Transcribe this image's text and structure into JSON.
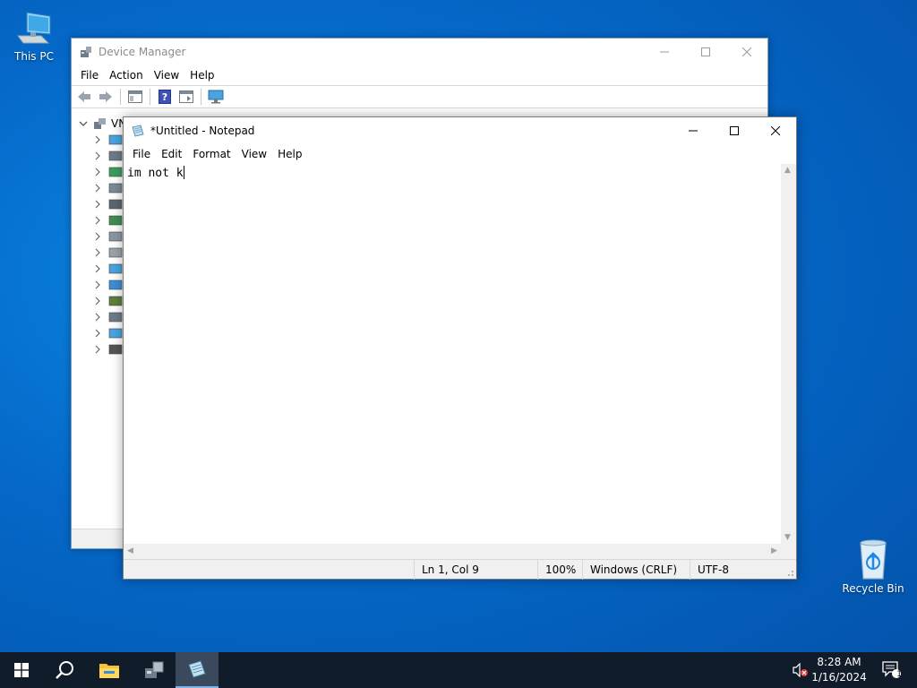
{
  "desktop": {
    "icons": [
      {
        "label": "This PC",
        "icon": "computer-icon"
      },
      {
        "label": "Recycle Bin",
        "icon": "recycle-bin-icon"
      }
    ]
  },
  "device_manager": {
    "title": "Device Manager",
    "menu": [
      "File",
      "Action",
      "View",
      "Help"
    ],
    "tree_root_label": "VN",
    "window_controls": [
      "minimize-icon",
      "maximize-icon",
      "close-icon"
    ]
  },
  "notepad": {
    "title": "*Untitled - Notepad",
    "menu": [
      "File",
      "Edit",
      "Format",
      "View",
      "Help"
    ],
    "content": "im not k",
    "status": {
      "position": "Ln 1, Col 9",
      "zoom": "100%",
      "line_ending": "Windows (CRLF)",
      "encoding": "UTF-8"
    }
  },
  "taskbar": {
    "clock_time": "8:28 AM",
    "clock_date": "1/16/2024",
    "notification_count": "1",
    "accent": "#7eb4ea"
  }
}
